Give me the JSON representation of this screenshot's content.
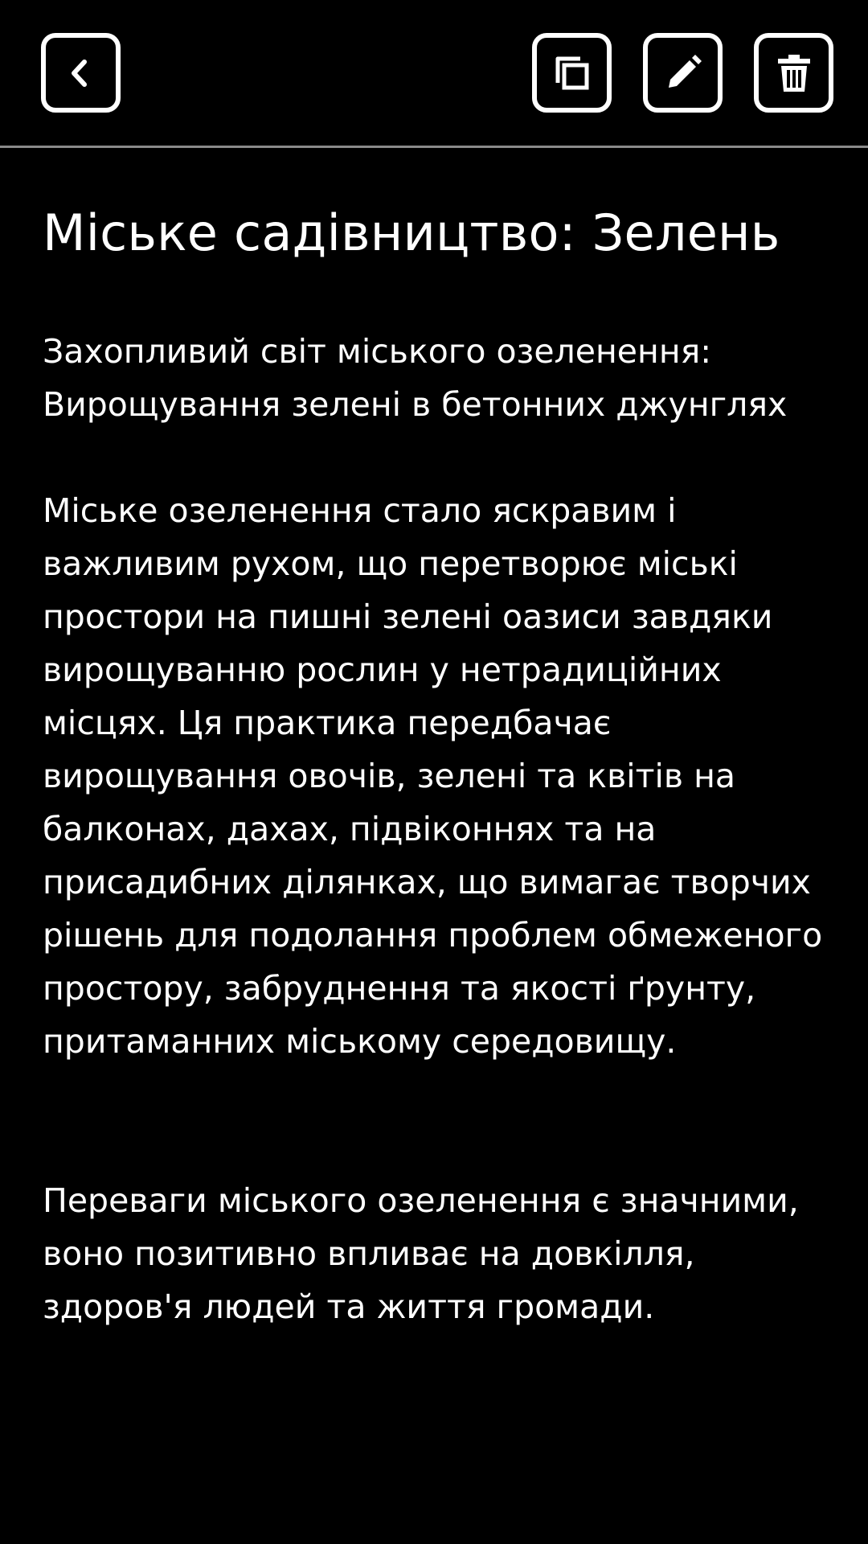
{
  "toolbar": {
    "back_icon": "chevron-left-icon",
    "copy_icon": "copy-icon",
    "edit_icon": "pencil-icon",
    "delete_icon": "trash-icon",
    "divider_color": "#8a8a8a"
  },
  "note": {
    "title": "Міське садівництво: Зелень",
    "subtitle": "Захопливий світ міського озеленення: Вирощування зелені в бетонних джунглях",
    "paragraphs": [
      "Міське озеленення стало яскравим і важливим рухом, що перетворює міські простори на пишні зелені оазиси завдяки вирощуванню рослин у нетрадиційних місцях. Ця практика передбачає вирощування овочів, зелені та квітів на балконах, дахах, підвіконнях та на присадибних ділянках, що вимагає творчих рішень для подолання проблем обмеженого простору, забруднення та якості ґрунту, притаманних міському середовищу.",
      "Переваги міського озеленення є значними, воно позитивно впливає на довкілля, здоров'я людей та життя громади."
    ]
  },
  "colors": {
    "background": "#000000",
    "text": "#ffffff"
  }
}
